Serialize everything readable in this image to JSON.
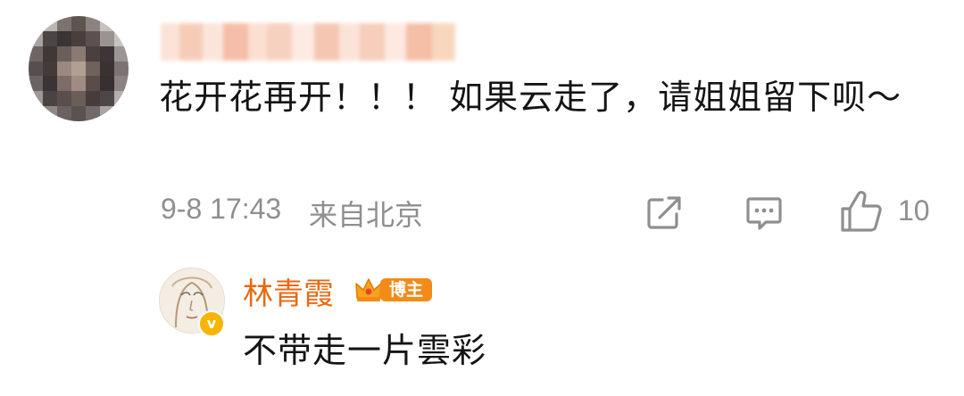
{
  "comment": {
    "text": "花开花再开！！！ 如果云走了，请姐姐留下呗～",
    "time": "9-8 17:43",
    "location": "来自北京",
    "like_count": "10"
  },
  "reply": {
    "author": "林青霞",
    "badge": "博主",
    "text": "不带走一片雲彩"
  },
  "icons": {
    "share": "share-icon",
    "reply": "comment-icon",
    "like": "thumbs-up-icon",
    "verified": "verified-icon"
  },
  "colors": {
    "author_name": "#e86a12",
    "badge": "#f28b1a",
    "meta": "#8f8f8f"
  }
}
